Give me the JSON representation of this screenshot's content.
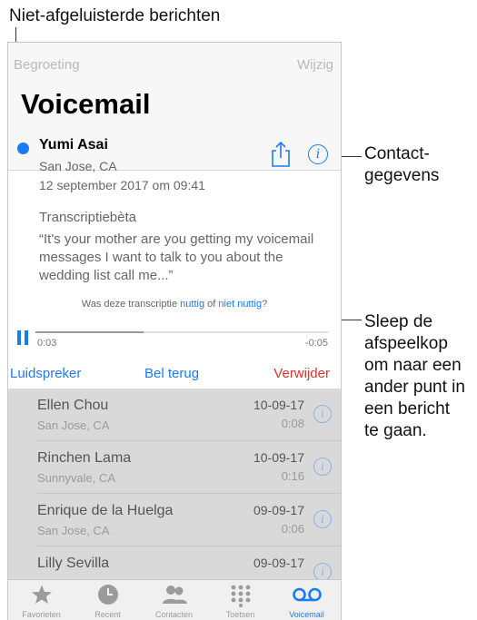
{
  "callouts": {
    "unread": "Niet-afgeluisterde berichten",
    "contact_1": "Contact-",
    "contact_2": "gegevens",
    "scrub_1": "Sleep de",
    "scrub_2": "afspeelkop",
    "scrub_3": "om naar een",
    "scrub_4": "ander punt in",
    "scrub_5": "een bericht",
    "scrub_6": "te gaan."
  },
  "nav": {
    "back": "Begroeting",
    "edit": "Wijzig",
    "title": "Voicemail"
  },
  "message": {
    "name": "Yumi Asai",
    "location": "San Jose, CA",
    "date": "12 september 2017 om 09:41",
    "transcript_title": "Transcriptiebèta",
    "transcript": "“It's your mother are you getting my voicemail messages I want to talk to you about the wedding list call me...”",
    "feedback_prefix": "Was deze transcriptie",
    "feedback_useful": "nuttig",
    "feedback_or": "of",
    "feedback_not_useful": "niet nuttig",
    "feedback_suffix": "?",
    "elapsed": "0:03",
    "remaining": "-0:05",
    "progress_fraction": 0.37,
    "speaker": "Luidspreker",
    "call_back": "Bel terug",
    "delete": "Verwijder"
  },
  "list": [
    {
      "name": "Ellen Chou",
      "location": "San Jose, CA",
      "date": "10-09-17",
      "duration": "0:08"
    },
    {
      "name": "Rinchen Lama",
      "location": "Sunnyvale, CA",
      "date": "10-09-17",
      "duration": "0:16"
    },
    {
      "name": "Enrique de la Huelga",
      "location": "San Jose, CA",
      "date": "09-09-17",
      "duration": "0:06"
    },
    {
      "name": "Lilly Sevilla",
      "location": "",
      "date": "09-09-17",
      "duration": ""
    }
  ],
  "tabs": [
    {
      "label": "Favorieten",
      "icon": "star-icon"
    },
    {
      "label": "Recent",
      "icon": "clock-icon"
    },
    {
      "label": "Contacten",
      "icon": "contacts-icon"
    },
    {
      "label": "Toetsen",
      "icon": "keypad-icon"
    },
    {
      "label": "Voicemail",
      "icon": "voicemail-icon"
    }
  ],
  "colors": {
    "accent": "#1a7cf5",
    "destructive": "#e0302c",
    "list_bg": "#d9d9d9"
  }
}
